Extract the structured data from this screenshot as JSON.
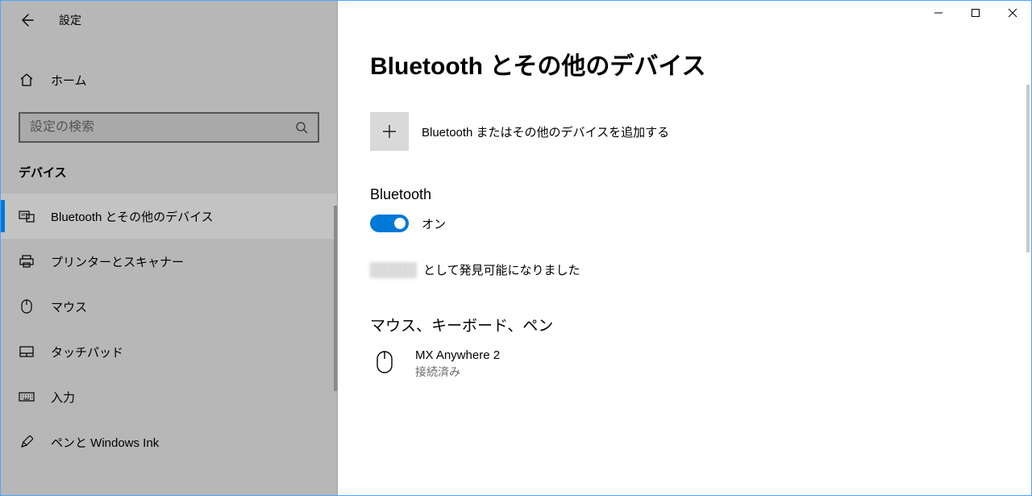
{
  "titlebar": {
    "minimize": "—",
    "maximize": "□",
    "close": "✕"
  },
  "sidebar": {
    "back_icon": "back",
    "title": "設定",
    "home_label": "ホーム",
    "search_placeholder": "設定の検索",
    "section_label": "デバイス",
    "items": [
      {
        "icon": "bt-devices",
        "label": "Bluetooth とその他のデバイス",
        "active": true
      },
      {
        "icon": "printer",
        "label": "プリンターとスキャナー"
      },
      {
        "icon": "mouse",
        "label": "マウス"
      },
      {
        "icon": "touchpad",
        "label": "タッチパッド"
      },
      {
        "icon": "keyboard",
        "label": "入力"
      },
      {
        "icon": "pen",
        "label": "ペンと Windows Ink"
      }
    ]
  },
  "main": {
    "title": "Bluetooth とその他のデバイス",
    "add_label": "Bluetooth またはその他のデバイスを追加する",
    "bt_label": "Bluetooth",
    "toggle_state": "オン",
    "discoverable_suffix": "として発見可能になりました",
    "device_section": "マウス、キーボード、ペン",
    "devices": [
      {
        "name": "MX Anywhere 2",
        "status": "接続済み"
      }
    ]
  }
}
